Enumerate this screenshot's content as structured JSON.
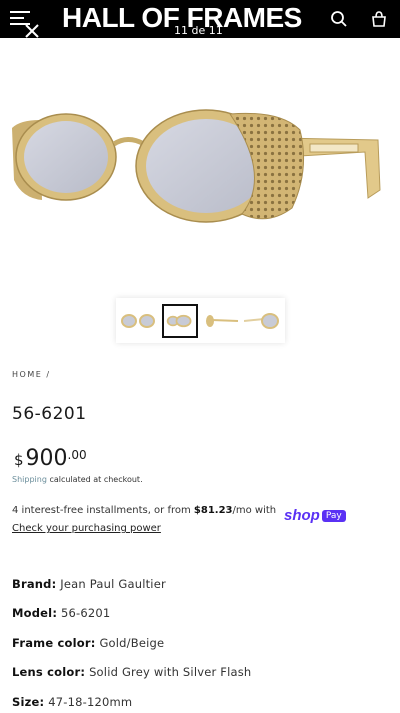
{
  "header": {
    "logo": "HALL OF FRAMES",
    "counter": "11 de 11"
  },
  "product": {
    "breadcrumb": "HOME /",
    "title": "56-6201",
    "price_currency": "$",
    "price_main": "900",
    "price_cents": ".00",
    "shipping_link": "Shipping",
    "shipping_text": "calculated at checkout."
  },
  "installments": {
    "text_prefix": "4 interest-free installments, or from ",
    "amount": "$81.23",
    "text_suffix": "/mo with",
    "shop_label": "shop",
    "pay_label": "Pay",
    "check_link": "Check your purchasing power"
  },
  "specs": [
    {
      "label": "Brand:",
      "value": "Jean Paul Gaultier"
    },
    {
      "label": "Model:",
      "value": "56-6201"
    },
    {
      "label": "Frame color:",
      "value": "Gold/Beige"
    },
    {
      "label": "Lens color:",
      "value": "Solid Grey with Silver Flash"
    },
    {
      "label": "Size:",
      "value": "47-18-120mm"
    }
  ],
  "colors": {
    "header_bg": "#000000",
    "frame_gold": "#d9bf7e",
    "lens": "#c8cbd6",
    "shop_pay": "#5a31f4"
  },
  "icons": [
    "menu-icon",
    "search-icon",
    "cart-icon",
    "close-icon"
  ]
}
